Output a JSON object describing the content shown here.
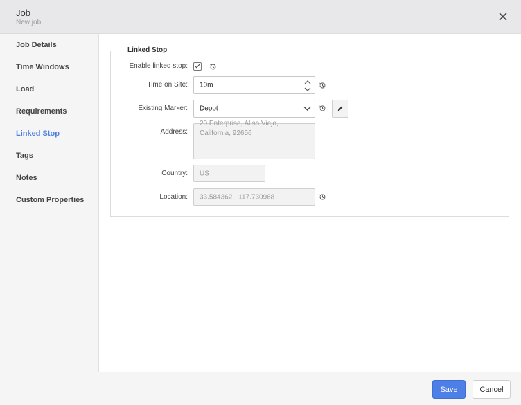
{
  "dialog": {
    "title": "Job",
    "subtitle": "New job"
  },
  "sidebar": {
    "items": [
      {
        "label": "Job Details",
        "active": false
      },
      {
        "label": "Time Windows",
        "active": false
      },
      {
        "label": "Load",
        "active": false
      },
      {
        "label": "Requirements",
        "active": false
      },
      {
        "label": "Linked Stop",
        "active": true
      },
      {
        "label": "Tags",
        "active": false
      },
      {
        "label": "Notes",
        "active": false
      },
      {
        "label": "Custom Properties",
        "active": false
      }
    ]
  },
  "linked_stop": {
    "legend": "Linked Stop",
    "enable_label": "Enable linked stop:",
    "enable_checked": true,
    "time_label": "Time on Site:",
    "time_value": "10m",
    "marker_label": "Existing Marker:",
    "marker_value": "Depot",
    "address_label": "Address:",
    "address_value": "20 Enterprise, Aliso Viejo, California, 92656",
    "country_label": "Country:",
    "country_value": "US",
    "location_label": "Location:",
    "location_value": "33.584362, -117.730968"
  },
  "footer": {
    "save_label": "Save",
    "cancel_label": "Cancel"
  },
  "colors": {
    "accent": "#4d7fe6",
    "active_nav": "#4a7fe0"
  }
}
